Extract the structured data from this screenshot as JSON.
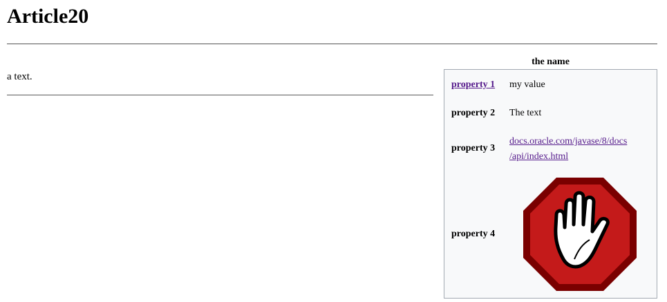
{
  "article": {
    "title": "Article20",
    "body_text": "a text."
  },
  "infobox": {
    "caption": "the name",
    "rows": [
      {
        "label": "property 1",
        "value": "my value"
      },
      {
        "label": "property 2",
        "value": "The text"
      },
      {
        "label": "property 3",
        "link_line1": "docs.oracle.com/javase/8/docs",
        "link_line2": "/api/index.html"
      },
      {
        "label": "property 4",
        "image": "stop-hand-icon"
      }
    ]
  },
  "colors": {
    "link": "#551a8b",
    "infobox_bg": "#f8f9fa",
    "infobox_border": "#a2a9b1",
    "stop_red": "#c41a1a",
    "stop_dark": "#7a0000"
  }
}
